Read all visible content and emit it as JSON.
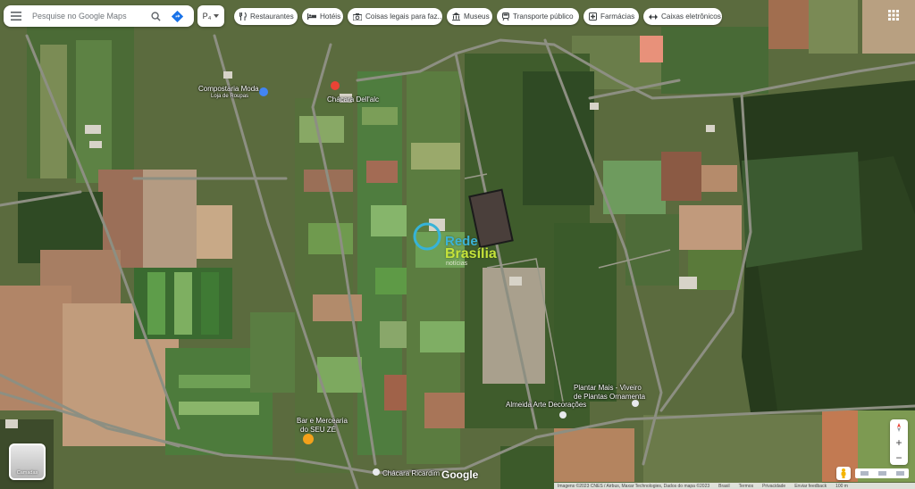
{
  "search": {
    "placeholder": "Pesquise no Google Maps"
  },
  "pin_button": {
    "label": "P₄"
  },
  "icons": {
    "menu": "menu-icon",
    "search": "search-icon",
    "directions": "directions-icon",
    "apps": "apps-grid-icon"
  },
  "chips": [
    {
      "label": "Restaurantes",
      "icon": "restaurant-icon"
    },
    {
      "label": "Hotéis",
      "icon": "hotel-icon"
    },
    {
      "label": "Coisas legais para faz...",
      "icon": "camera-icon"
    },
    {
      "label": "Museus",
      "icon": "museum-icon"
    },
    {
      "label": "Transporte público",
      "icon": "train-icon"
    },
    {
      "label": "Farmácias",
      "icon": "pharmacy-icon"
    },
    {
      "label": "Caixas eletrônicos",
      "icon": "atm-icon"
    }
  ],
  "places": {
    "compostaria": "Compostaria Moda",
    "compostaria_sub": "Loja de Roupas",
    "chacara": "Chácara Dell'alc",
    "bar": "Bar e Mercearia",
    "bar2": "do SEU ZÉ",
    "plantar1": "Plantar Mais - Viveiro",
    "plantar2": "de Plantas Ornamenta",
    "almeida": "Almeida Arte Decorações",
    "ricardim": "Chácara Ricardim"
  },
  "watermark": {
    "line1": "Rede",
    "line2": "Brasília",
    "line3": "notícias"
  },
  "layers": {
    "label": "Camadas"
  },
  "zoom": {
    "in": "+",
    "out": "−"
  },
  "google_logo": "Google",
  "footer": {
    "imagery": "Imagens ©2023 CNES / Airbus, Maxar Technologies, Dados do mapa ©2023",
    "brazil": "Brasil",
    "terms": "Termos",
    "privacy": "Privacidade",
    "feedback": "Enviar feedback",
    "scale": "100 m"
  },
  "colors": {
    "pin_red": "#ea4335",
    "place_blue": "#4285f4",
    "bar_orange": "#f4a11b"
  }
}
